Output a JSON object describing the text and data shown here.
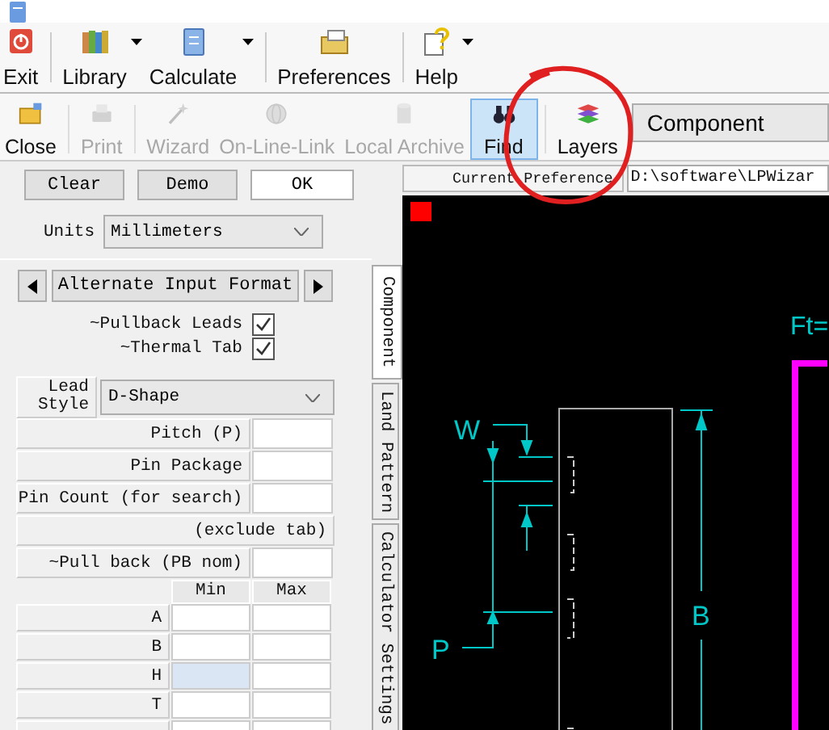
{
  "main_toolbar": [
    {
      "label": "Exit",
      "kind": "exit",
      "dropdown": false
    },
    {
      "label": "Library",
      "kind": "library",
      "dropdown": true
    },
    {
      "label": "Calculate",
      "kind": "calculate",
      "dropdown": true
    },
    {
      "label": "Preferences",
      "kind": "preferences",
      "dropdown": false
    },
    {
      "label": "Help",
      "kind": "help",
      "dropdown": true
    }
  ],
  "tool_toolbar": [
    {
      "label": "Close",
      "kind": "close",
      "disabled": false,
      "selected": false
    },
    {
      "label": "Print",
      "kind": "print",
      "disabled": true,
      "selected": false
    },
    {
      "label": "Wizard",
      "kind": "wizard",
      "disabled": true,
      "selected": false
    },
    {
      "label": "On-Line-Link",
      "kind": "online",
      "disabled": true,
      "selected": false
    },
    {
      "label": "Local Archive",
      "kind": "archive",
      "disabled": true,
      "selected": false
    },
    {
      "label": "Find",
      "kind": "find",
      "disabled": false,
      "selected": true
    },
    {
      "label": "Layers",
      "kind": "layers",
      "disabled": false,
      "selected": false
    }
  ],
  "view_dropdown": {
    "value": "Component"
  },
  "buttons": [
    {
      "label": "Clear",
      "default": false
    },
    {
      "label": "Demo",
      "default": false
    },
    {
      "label": "OK",
      "default": true
    }
  ],
  "units": {
    "label": "Units",
    "value": "Millimeters"
  },
  "input_format": {
    "label": "Alternate Input Format"
  },
  "options": [
    {
      "label": "~Pullback Leads",
      "checked": true
    },
    {
      "label": "~Thermal Tab",
      "checked": true
    }
  ],
  "lead_style": {
    "label": "Lead Style",
    "value": "D-Shape"
  },
  "fields": [
    {
      "label": "Pitch (P)",
      "kind": "input"
    },
    {
      "label": "Pin Package",
      "kind": "input"
    },
    {
      "label": "Pin Count (for search)",
      "kind": "input"
    },
    {
      "label": "(exclude tab)",
      "kind": "note"
    },
    {
      "label": "~Pull back (PB nom)",
      "kind": "input"
    }
  ],
  "dimensions": {
    "columns": [
      "Min",
      "Max"
    ],
    "rows": [
      {
        "label": "A",
        "selected": false
      },
      {
        "label": "B",
        "selected": false
      },
      {
        "label": "H",
        "selected": true
      },
      {
        "label": "T",
        "selected": false
      }
    ]
  },
  "side_tabs": [
    {
      "label": "Component",
      "selected": true
    },
    {
      "label": "Land Pattern",
      "selected": false
    },
    {
      "label": "Calculator Settings",
      "selected": false
    }
  ],
  "current_preference": {
    "label": "Current Preference",
    "value": "D:\\software\\LPWizar"
  },
  "drawing": {
    "labels": [
      "Ft=",
      "W",
      "P",
      "B"
    ]
  }
}
